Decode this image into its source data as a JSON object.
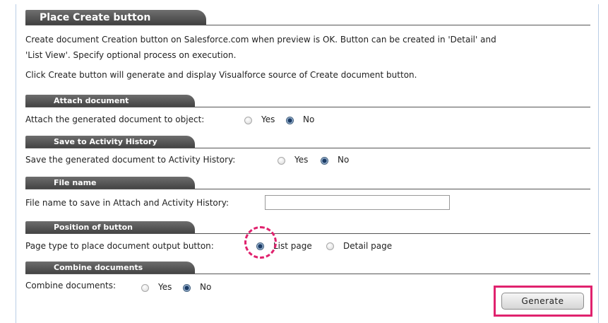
{
  "header": {
    "title": "Place Create button"
  },
  "intro": {
    "line1": "Create document Creation button on Salesforce.com when preview is OK. Button can be created in 'Detail' and",
    "line2": "'List View'. Specify optional process on execution.",
    "line3": "Click Create button will generate and display Visualforce source of Create document button."
  },
  "sections": {
    "attach": {
      "title": "Attach document",
      "label": "Attach the generated document to object:",
      "options": [
        "Yes",
        "No"
      ],
      "selected": "No"
    },
    "save_history": {
      "title": "Save to Activity History",
      "label": "Save the generated document to Activity History:",
      "options": [
        "Yes",
        "No"
      ],
      "selected": "No"
    },
    "file_name": {
      "title": "File name",
      "label": "File name to save in Attach and Activity History:",
      "value": ""
    },
    "position": {
      "title": "Position of button",
      "label": "Page type to place document output button:",
      "options": [
        "List page",
        "Detail page"
      ],
      "selected": "List page"
    },
    "combine": {
      "title": "Combine documents",
      "label": "Combine documents:",
      "options": [
        "Yes",
        "No"
      ],
      "selected": "No"
    }
  },
  "actions": {
    "generate_label": "Generate"
  },
  "colors": {
    "highlight": "#e0226e",
    "tab_bg": "#4a4a4a",
    "frame": "#b9cde6"
  }
}
